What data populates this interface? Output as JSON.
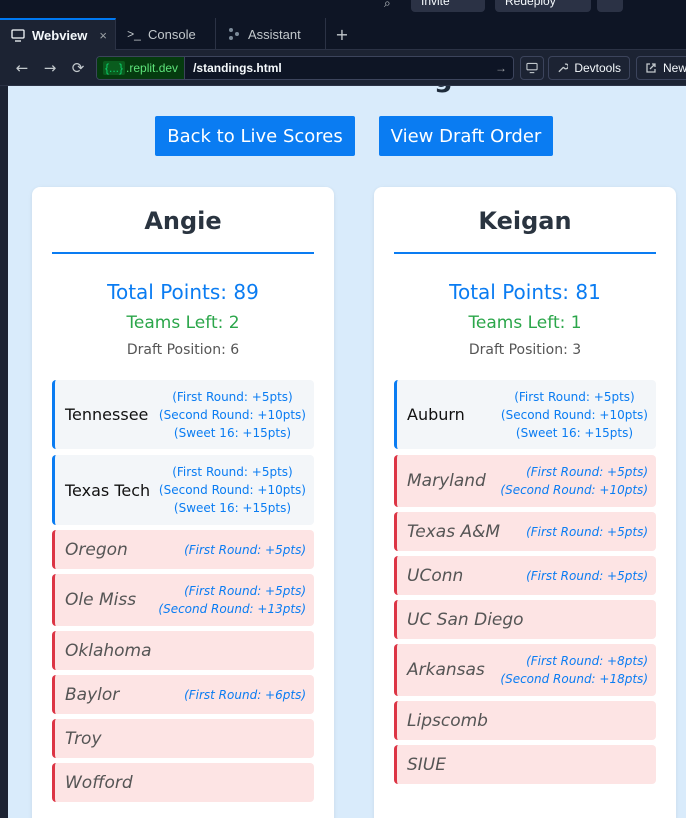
{
  "topbar": {
    "btn1": "Invite",
    "btn2": "Redeploy"
  },
  "tabs": [
    {
      "label": "Webview",
      "close": "×"
    },
    {
      "label": "Console"
    },
    {
      "label": "Assistant"
    }
  ],
  "tab_add": "+",
  "urlbar": {
    "domain_prefix": "{...}",
    "domain": ".replit.dev",
    "path": "/standings.html",
    "devtools": "Devtools",
    "new_tab": "New"
  },
  "page": {
    "back_button": "Back to Live Scores",
    "draft_button": "View Draft Order",
    "players": [
      {
        "name": "Angie",
        "total": "Total Points: 89",
        "teams_left": "Teams Left: 2",
        "draft_position": "Draft Position: 6",
        "teams": [
          {
            "name": "Tennessee",
            "status": "alive",
            "points": [
              "(First Round: +5pts)",
              "(Second Round: +10pts)",
              "(Sweet 16: +15pts)"
            ]
          },
          {
            "name": "Texas Tech",
            "status": "alive",
            "points": [
              "(First Round: +5pts)",
              "(Second Round: +10pts)",
              "(Sweet 16: +15pts)"
            ]
          },
          {
            "name": "Oregon",
            "status": "out",
            "points": [
              "(First Round: +5pts)"
            ]
          },
          {
            "name": "Ole Miss",
            "status": "out",
            "points": [
              "(First Round: +5pts)",
              "(Second Round: +13pts)"
            ]
          },
          {
            "name": "Oklahoma",
            "status": "out",
            "points": []
          },
          {
            "name": "Baylor",
            "status": "out",
            "points": [
              "(First Round: +6pts)"
            ]
          },
          {
            "name": "Troy",
            "status": "out",
            "points": []
          },
          {
            "name": "Wofford",
            "status": "out",
            "points": []
          }
        ]
      },
      {
        "name": "Keigan",
        "total": "Total Points: 81",
        "teams_left": "Teams Left: 1",
        "draft_position": "Draft Position: 3",
        "teams": [
          {
            "name": "Auburn",
            "status": "alive",
            "points": [
              "(First Round: +5pts)",
              "(Second Round: +10pts)",
              "(Sweet 16: +15pts)"
            ]
          },
          {
            "name": "Maryland",
            "status": "out",
            "points": [
              "(First Round: +5pts)",
              "(Second Round: +10pts)"
            ]
          },
          {
            "name": "Texas A&M",
            "status": "out",
            "points": [
              "(First Round: +5pts)"
            ]
          },
          {
            "name": "UConn",
            "status": "out",
            "points": [
              "(First Round: +5pts)"
            ]
          },
          {
            "name": "UC San Diego",
            "status": "out",
            "points": []
          },
          {
            "name": "Arkansas",
            "status": "out",
            "points": [
              "(First Round: +8pts)",
              "(Second Round: +18pts)"
            ]
          },
          {
            "name": "Lipscomb",
            "status": "out",
            "points": []
          },
          {
            "name": "SIUE",
            "status": "out",
            "points": []
          }
        ]
      }
    ]
  }
}
